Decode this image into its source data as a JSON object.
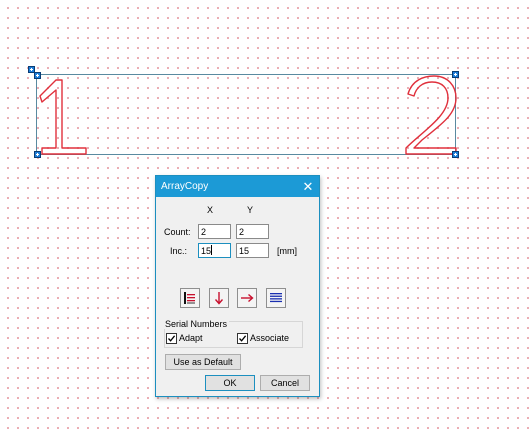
{
  "canvas": {
    "glyph_first": "1",
    "glyph_second": "2",
    "glyph_color": "#e0303c",
    "selection_color": "#5a8aa0",
    "grid_dot_color": "#e8a0a8"
  },
  "dialog": {
    "title": "ArrayCopy",
    "close_icon": "close-icon",
    "col_x": "X",
    "col_y": "Y",
    "count_label": "Count:",
    "inc_label": "Inc.:",
    "count_x": "2",
    "count_y": "2",
    "inc_x": "15",
    "inc_y": "15",
    "unit": "[mm]",
    "direction_buttons": [
      {
        "icon": "array-left-icon"
      },
      {
        "icon": "arrow-down-icon"
      },
      {
        "icon": "arrow-right-icon"
      },
      {
        "icon": "lines-icon"
      }
    ],
    "serial_group_title": "Serial Numbers",
    "adapt_label": "Adapt",
    "adapt_checked": true,
    "associate_label": "Associate",
    "associate_checked": true,
    "use_default_label": "Use as Default",
    "ok_label": "OK",
    "cancel_label": "Cancel",
    "title_color": "#1c9ad6"
  }
}
